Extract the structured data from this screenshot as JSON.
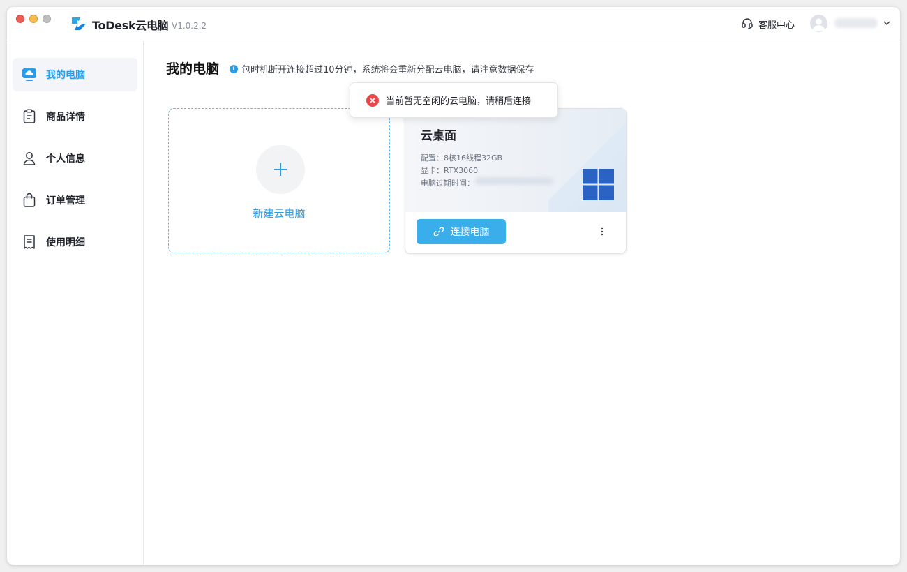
{
  "window": {
    "app_title": "ToDesk云电脑",
    "version": "V1.0.2.2"
  },
  "header": {
    "support_label": "客服中心",
    "support_icon": "headset-icon",
    "user_icon": "avatar-icon"
  },
  "sidebar": {
    "items": [
      {
        "label": "我的电脑",
        "icon": "cloud-monitor-icon",
        "active": true
      },
      {
        "label": "商品详情",
        "icon": "clipboard-icon",
        "active": false
      },
      {
        "label": "个人信息",
        "icon": "user-icon",
        "active": false
      },
      {
        "label": "订单管理",
        "icon": "shopping-bag-icon",
        "active": false
      },
      {
        "label": "使用明细",
        "icon": "receipt-icon",
        "active": false
      }
    ]
  },
  "main": {
    "title": "我的电脑",
    "notice": "包时机断开连接超过10分钟，系统将会重新分配云电脑，请注意数据保存",
    "new_card": {
      "label": "新建云电脑"
    },
    "pc_card": {
      "name": "云桌面",
      "spec_config": "配置：8核16线程32GB",
      "spec_gpu": "显卡：RTX3060",
      "spec_expiry": "电脑过期时间：",
      "connect_label": "连接电脑"
    }
  },
  "toast": {
    "message": "当前暂无空闲的云电脑，请稍后连接",
    "type": "error"
  },
  "colors": {
    "accent": "#2b9de8",
    "button": "#3aaeea",
    "error": "#e8484a",
    "windows_blue": "#2a63c4"
  }
}
